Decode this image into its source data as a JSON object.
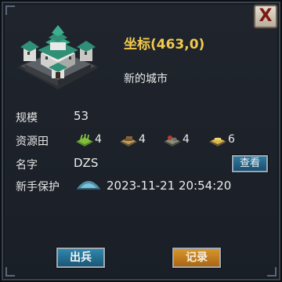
{
  "close": {
    "glyph": "X",
    "icon": "close-icon"
  },
  "city": {
    "image": "castle-icon",
    "coordinate_title": "坐标(463,0)",
    "type_label": "新的城市"
  },
  "scale": {
    "label": "规模",
    "value": "53"
  },
  "resources": {
    "label": "资源田",
    "items": [
      {
        "icon": "farm-field-icon",
        "count": "4"
      },
      {
        "icon": "lumber-field-icon",
        "count": "4"
      },
      {
        "icon": "stone-field-icon",
        "count": "4"
      },
      {
        "icon": "iron-field-icon",
        "count": "6"
      }
    ]
  },
  "name": {
    "label": "名字",
    "value": "DZS",
    "view_button": "查看"
  },
  "protection": {
    "label": "新手保护",
    "icon": "shield-dome-icon",
    "until": "2023-11-21 20:54:20"
  },
  "actions": {
    "deploy": "出兵",
    "record": "记录"
  },
  "colors": {
    "title": "#f2c94c",
    "deploy": "#2f88ad",
    "record": "#d8962c",
    "close": "#7c1815"
  }
}
